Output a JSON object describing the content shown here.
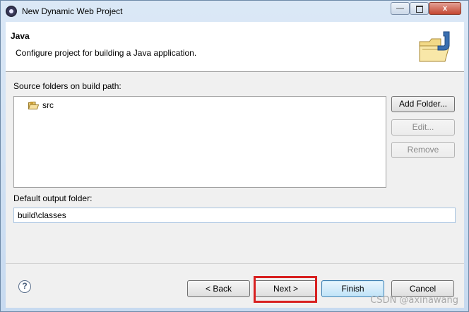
{
  "window": {
    "title": "New Dynamic Web Project",
    "controls": {
      "minimize": "—",
      "close": "x"
    }
  },
  "banner": {
    "title": "Java",
    "description": "Configure project for building a Java application.",
    "icon": "java-folder-icon"
  },
  "source_folders": {
    "label": "Source folders on build path:",
    "items": [
      {
        "label": "src",
        "icon": "source-folder-icon"
      }
    ],
    "buttons": {
      "add_folder": "Add Folder...",
      "edit": "Edit...",
      "remove": "Remove"
    }
  },
  "output": {
    "label": "Default output folder:",
    "value": "build\\classes"
  },
  "footer": {
    "help_icon": "?",
    "back": "< Back",
    "next": "Next >",
    "finish": "Finish",
    "cancel": "Cancel"
  },
  "watermark": "CSDN @axinawang",
  "colors": {
    "highlight": "#d82020",
    "default_button": "#3c7fb1"
  }
}
